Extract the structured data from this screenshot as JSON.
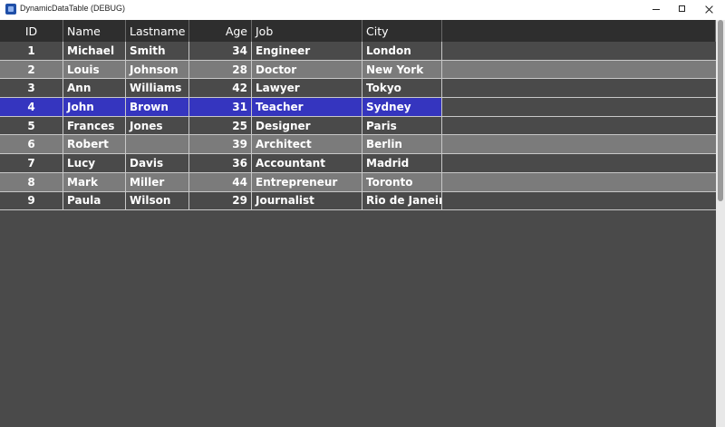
{
  "window": {
    "title": "DynamicDataTable (DEBUG)",
    "icon": "app-icon",
    "controls": [
      "minimize",
      "maximize",
      "close"
    ]
  },
  "table": {
    "columns": [
      "ID",
      "Name",
      "Lastname",
      "Age",
      "Job",
      "City"
    ],
    "selected_row_index": 3,
    "rows": [
      {
        "id": "1",
        "name": "Michael",
        "lastname": "Smith",
        "age": "34",
        "job": "Engineer",
        "city": "London"
      },
      {
        "id": "2",
        "name": "Louis",
        "lastname": "Johnson",
        "age": "28",
        "job": "Doctor",
        "city": "New York"
      },
      {
        "id": "3",
        "name": "Ann",
        "lastname": "Williams",
        "age": "42",
        "job": "Lawyer",
        "city": "Tokyo"
      },
      {
        "id": "4",
        "name": "John",
        "lastname": "Brown",
        "age": "31",
        "job": "Teacher",
        "city": "Sydney"
      },
      {
        "id": "5",
        "name": "Frances",
        "lastname": "Jones",
        "age": "25",
        "job": "Designer",
        "city": "Paris"
      },
      {
        "id": "6",
        "name": "Robert",
        "lastname": "",
        "age": "39",
        "job": "Architect",
        "city": "Berlin"
      },
      {
        "id": "7",
        "name": "Lucy",
        "lastname": "Davis",
        "age": "36",
        "job": "Accountant",
        "city": "Madrid"
      },
      {
        "id": "8",
        "name": "Mark",
        "lastname": "Miller",
        "age": "44",
        "job": "Entrepreneur",
        "city": "Toronto"
      },
      {
        "id": "9",
        "name": "Paula",
        "lastname": "Wilson",
        "age": "29",
        "job": "Journalist",
        "city": "Rio de Janeiro"
      }
    ]
  },
  "colors": {
    "background": "#4a4a4a",
    "header": "#2e2e2e",
    "row_dark": "#4a4a4a",
    "row_light": "#7b7b7b",
    "selected_row": "#3535bf",
    "text": "#ffffff"
  }
}
